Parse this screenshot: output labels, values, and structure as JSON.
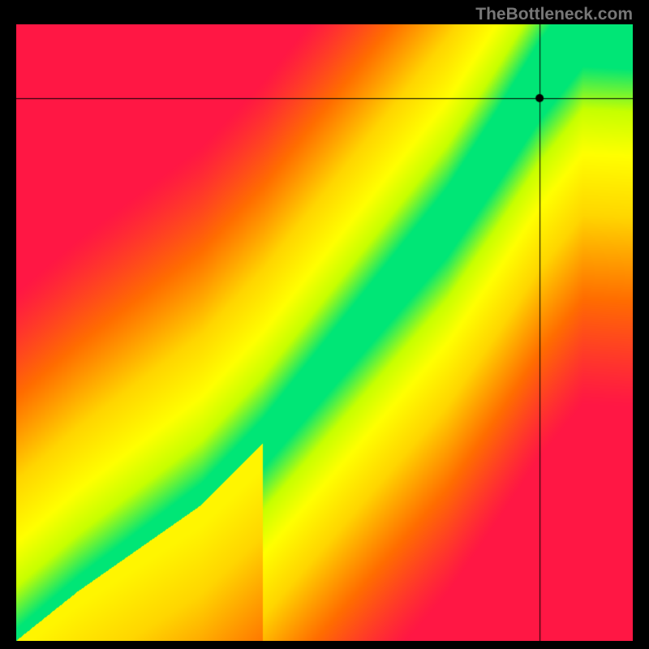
{
  "watermark": "TheBottleneck.com",
  "chart_data": {
    "type": "heatmap",
    "title": "",
    "xlabel": "",
    "ylabel": "",
    "xlim": [
      0,
      100
    ],
    "ylim": [
      0,
      100
    ],
    "crosshair": {
      "x": 85,
      "y": 88
    },
    "optimal_curve": [
      {
        "x": 0,
        "y": 0
      },
      {
        "x": 10,
        "y": 8
      },
      {
        "x": 20,
        "y": 15
      },
      {
        "x": 30,
        "y": 22
      },
      {
        "x": 40,
        "y": 32
      },
      {
        "x": 50,
        "y": 44
      },
      {
        "x": 60,
        "y": 56
      },
      {
        "x": 70,
        "y": 68
      },
      {
        "x": 78,
        "y": 80
      },
      {
        "x": 85,
        "y": 91
      },
      {
        "x": 92,
        "y": 100
      }
    ],
    "color_scale": [
      {
        "value": 0.0,
        "color": "#ff1744"
      },
      {
        "value": 0.25,
        "color": "#ff6d00"
      },
      {
        "value": 0.5,
        "color": "#ffd600"
      },
      {
        "value": 0.7,
        "color": "#ffff00"
      },
      {
        "value": 0.85,
        "color": "#c6ff00"
      },
      {
        "value": 1.0,
        "color": "#00e676"
      }
    ],
    "band_half_width_pct": 6
  }
}
